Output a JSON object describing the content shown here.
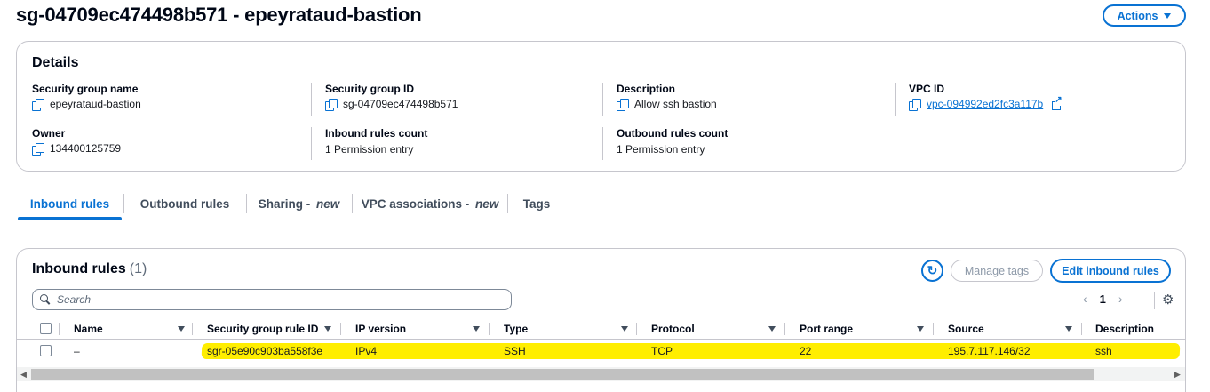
{
  "header": {
    "title": "sg-04709ec474498b571 - epeyrataud-bastion",
    "actions_label": "Actions"
  },
  "details": {
    "title": "Details",
    "fields": [
      {
        "label": "Security group name",
        "value": "epeyrataud-bastion"
      },
      {
        "label": "Security group ID",
        "value": "sg-04709ec474498b571"
      },
      {
        "label": "Description",
        "value": "Allow ssh bastion"
      },
      {
        "label": "VPC ID",
        "value": "vpc-094992ed2fc3a117b"
      },
      {
        "label": "Owner",
        "value": "134400125759"
      },
      {
        "label": "Inbound rules count",
        "value": "1 Permission entry"
      },
      {
        "label": "Outbound rules count",
        "value": "1 Permission entry"
      }
    ]
  },
  "tabs": [
    {
      "label": "Inbound rules",
      "suffix": ""
    },
    {
      "label": "Outbound rules",
      "suffix": ""
    },
    {
      "label": "Sharing - ",
      "suffix": "new"
    },
    {
      "label": "VPC associations - ",
      "suffix": "new"
    },
    {
      "label": "Tags",
      "suffix": ""
    }
  ],
  "inbound": {
    "title": "Inbound rules",
    "count": "(1)",
    "manage_tags_label": "Manage tags",
    "edit_label": "Edit inbound rules",
    "search_placeholder": "Search",
    "page": "1",
    "columns": [
      "Name",
      "Security group rule ID",
      "IP version",
      "Type",
      "Protocol",
      "Port range",
      "Source",
      "Description"
    ],
    "rows": [
      {
        "name": "–",
        "rule_id": "sgr-05e90c903ba558f3e",
        "ip_version": "IPv4",
        "type": "SSH",
        "protocol": "TCP",
        "port_range": "22",
        "source": "195.7.117.146/32",
        "description": "ssh"
      }
    ]
  },
  "colors": {
    "accent": "#0972d3",
    "highlight": "#ffee00"
  }
}
